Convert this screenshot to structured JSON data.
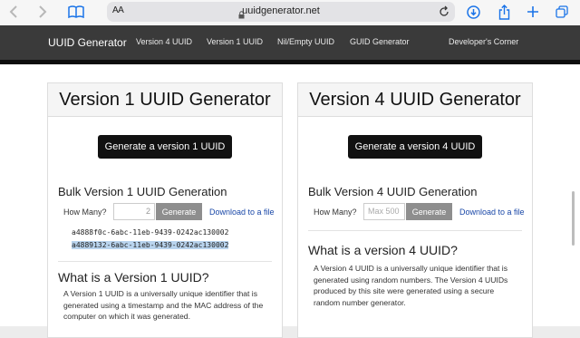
{
  "browser": {
    "text_size_label": "AA",
    "url": "uuidgenerator.net"
  },
  "nav": {
    "brand": "UUID Generator",
    "links": [
      "Version 4 UUID",
      "Version 1 UUID",
      "Nil/Empty UUID",
      "GUID Generator",
      "Developer's Corner"
    ]
  },
  "v1": {
    "title": "Version 1 UUID Generator",
    "generate_label": "Generate a version 1 UUID",
    "bulk_title": "Bulk Version 1 UUID Generation",
    "how_many_label": "How Many?",
    "quantity_value": "2",
    "generate_small_label": "Generate",
    "download_label": "Download to a file",
    "uuids": [
      "a4888f0c-6abc-11eb-9439-0242ac130002",
      "a4889132-6abc-11eb-9439-0242ac130002"
    ],
    "what_title": "What is a Version 1 UUID?",
    "what_text": "A Version 1 UUID is a universally unique identifier that is generated using a timestamp and the MAC address of the computer on which it was generated."
  },
  "v4": {
    "title": "Version 4 UUID Generator",
    "generate_label": "Generate a version 4 UUID",
    "bulk_title": "Bulk Version 4 UUID Generation",
    "how_many_label": "How Many?",
    "quantity_placeholder": "Max 500",
    "generate_small_label": "Generate",
    "download_label": "Download to a file",
    "what_title": "What is a version 4 UUID?",
    "what_text": "A Version 4 UUID is a universally unique identifier that is generated using random numbers. The Version 4 UUIDs produced by this site were generated using a secure random number generator."
  },
  "colors": {
    "navbar": "#3a3a3a",
    "button": "#111111",
    "link": "#1a48a8",
    "selection": "#b9d4ee",
    "safari_blue": "#1a73e8"
  },
  "icons": [
    "back-icon",
    "forward-icon",
    "bookmarks-icon",
    "lock-icon",
    "reload-icon",
    "downloads-icon",
    "share-icon",
    "new-tab-icon",
    "tabs-icon"
  ]
}
